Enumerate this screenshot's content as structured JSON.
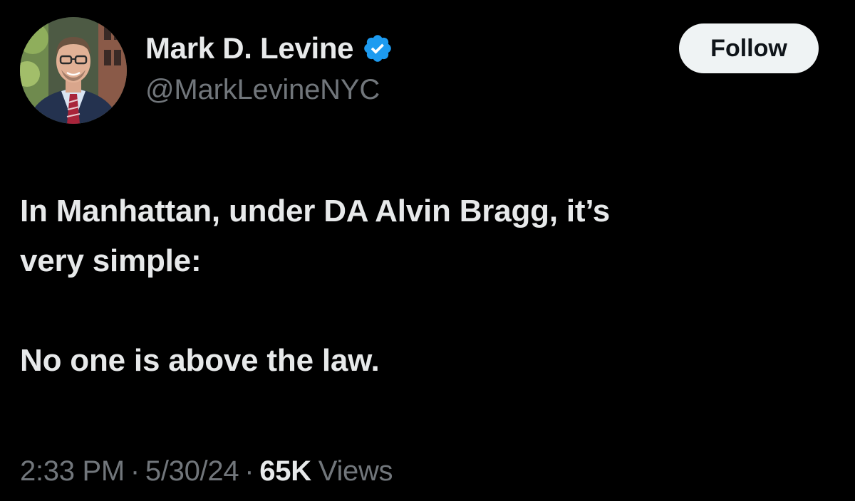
{
  "author": {
    "display_name": "Mark D. Levine",
    "handle": "@MarkLevineNYC",
    "verified": true,
    "verified_color": "#1d9bf0"
  },
  "follow_button": {
    "label": "Follow"
  },
  "tweet": {
    "lines": [
      "In Manhattan, under DA Alvin Bragg, it’s\nvery simple:",
      "No one is above the law."
    ]
  },
  "meta": {
    "time": "2:33 PM",
    "separator": "·",
    "date": "5/30/24",
    "views_count": "65K",
    "views_label": "Views"
  },
  "colors": {
    "background": "#000000",
    "primary_text": "#e7e9ea",
    "secondary_text": "#71767b",
    "button_bg": "#eff3f4",
    "button_text": "#0f1419"
  },
  "icons": {
    "verified": "verified-badge-icon"
  }
}
